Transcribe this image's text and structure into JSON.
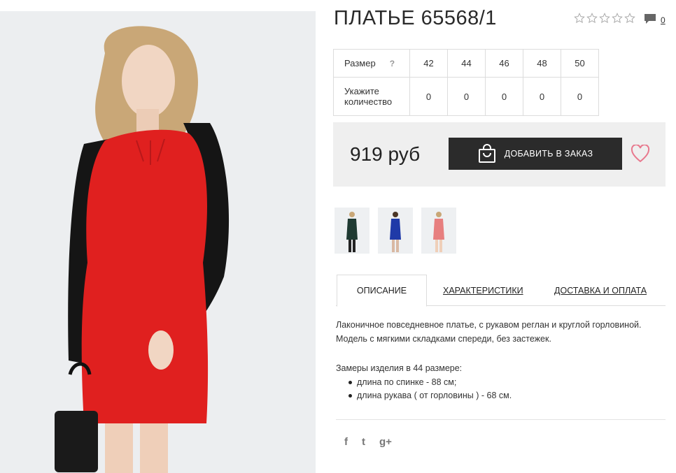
{
  "product": {
    "title": "ПЛАТЬЕ 65568/1",
    "rating_stars": 5,
    "rating_value": 0,
    "comments_count": "0"
  },
  "sizes": {
    "size_label": "Размер",
    "help": "?",
    "qty_label": "Укажите количество",
    "values": [
      "42",
      "44",
      "46",
      "48",
      "50"
    ],
    "quantities": [
      "0",
      "0",
      "0",
      "0",
      "0"
    ]
  },
  "purchase": {
    "price": "919 руб",
    "add_button": "ДОБАВИТЬ В ЗАКАЗ"
  },
  "thumbnails": [
    {
      "name": "green-dress",
      "color": "#1f3a32"
    },
    {
      "name": "blue-dress",
      "color": "#1f3aa8"
    },
    {
      "name": "red-dress",
      "color": "#e0373a"
    }
  ],
  "tabs": {
    "description": "ОПИСАНИЕ",
    "specs": "ХАРАКТЕРИСТИКИ",
    "delivery": "ДОСТАВКА И ОПЛАТА"
  },
  "description": {
    "line1": "Лаконичное повседневное платье, с рукавом реглан и круглой горловиной.",
    "line2": "Модель с мягкими складками спереди, без застежек.",
    "measure_title": "Замеры изделия в 44 размере:",
    "measure_items": [
      "длина по спинке - 88 см;",
      "длина рукава ( от горловины ) - 68 см."
    ]
  },
  "social": {
    "facebook": "f",
    "twitter": "t",
    "google": "g+"
  },
  "colors": {
    "dress_red": "#e0201f",
    "sleeve_black": "#151515",
    "button_dark": "#2b2b2b",
    "heart_pink": "#e8788d"
  }
}
